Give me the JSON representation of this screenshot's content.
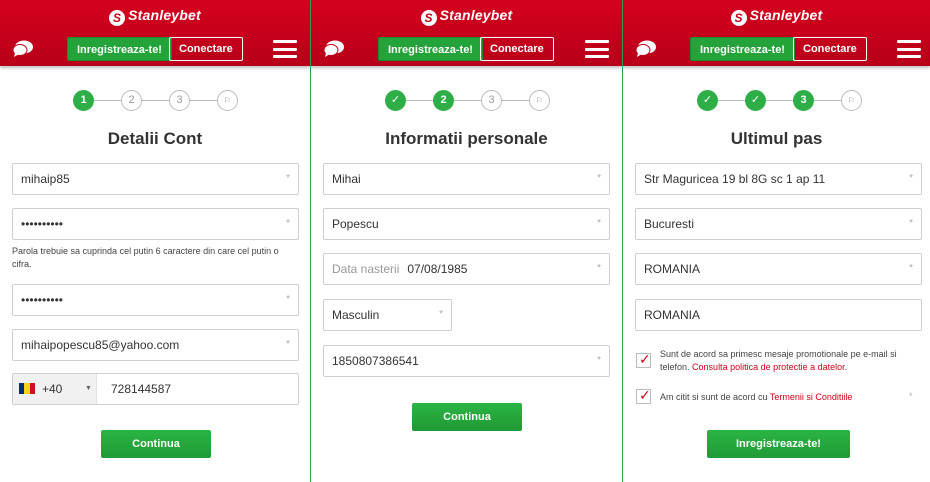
{
  "header": {
    "logo_text": "Stanleybet",
    "logo_mark": "S",
    "register_label": "Inregistreaza-te!",
    "login_label": "Conectare",
    "icons": [
      "chat-icon",
      "menu-icon"
    ]
  },
  "colors": {
    "header_red": "#c8001c",
    "accent_green": "#2fae48",
    "link_red": "#d0021b"
  },
  "panel1": {
    "steps": [
      "1",
      "2",
      "3"
    ],
    "title": "Detalii Cont",
    "username": "mihaip85",
    "password": "••••••••••",
    "password_hint": "Parola trebuie sa cuprinda cel putin 6 caractere din care cel putin o cifra.",
    "password_confirm": "••••••••••",
    "email": "mihaipopescu85@yahoo.com",
    "phone_prefix": "+40",
    "phone_number": "728144587",
    "required_mark": "*",
    "continue_label": "Continua"
  },
  "panel2": {
    "steps": [
      "2",
      "3"
    ],
    "title": "Informatii personale",
    "first_name": "Mihai",
    "last_name": "Popescu",
    "birth_label": "Data nasterii",
    "birth_value": "07/08/1985",
    "gender": "Masculin",
    "cnp": "1850807386541",
    "continue_label": "Continua"
  },
  "panel3": {
    "steps": [
      "3"
    ],
    "title": "Ultimul pas",
    "address": "Str Maguricea 19 bl 8G sc 1 ap 11",
    "city": "Bucuresti",
    "county": "ROMANIA",
    "country": "ROMANIA",
    "promo_text": "Sunt de acord sa primesc mesaje promotionale pe e-mail si telefon.",
    "promo_link": "Consulta politica de protectie a datelor.",
    "terms_text": "Am citit si sunt de acord cu",
    "terms_link": "Termenii si Conditiile",
    "register_label": "Inregistreaza-te!"
  }
}
